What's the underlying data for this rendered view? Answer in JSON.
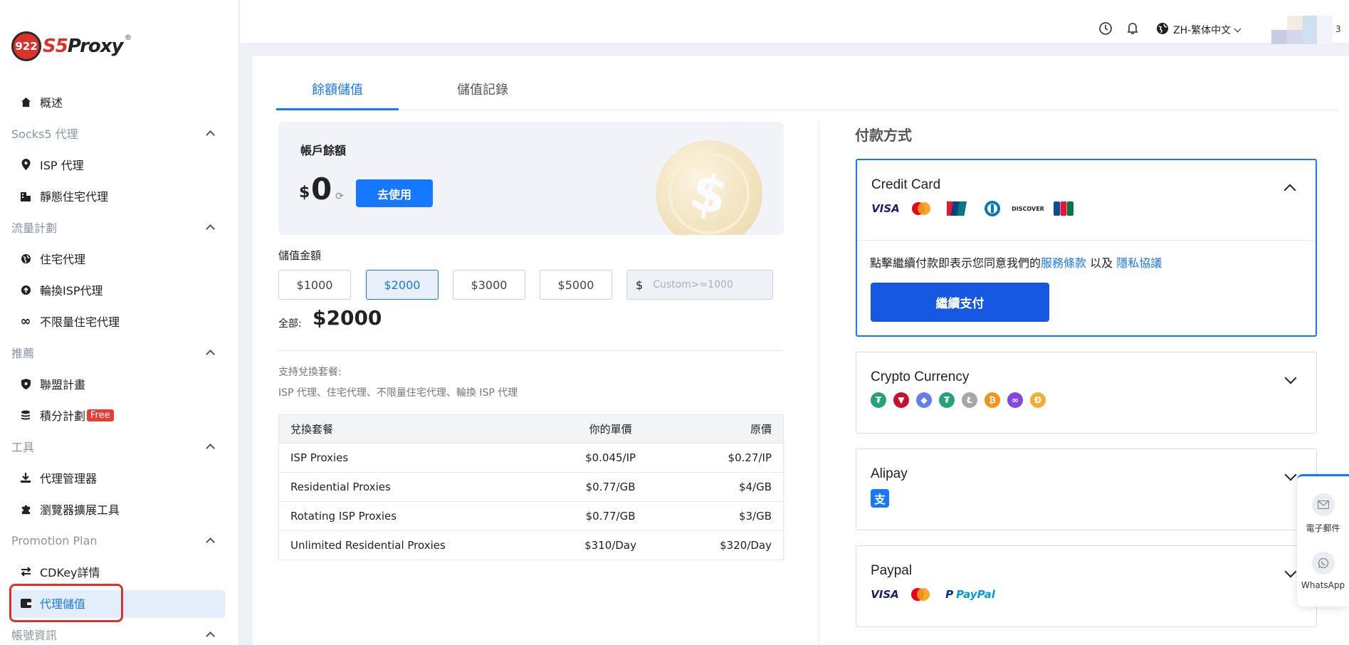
{
  "brand": {
    "logo_badge": "922",
    "logo_name_a": "S5",
    "logo_name_b": "Proxy",
    "registered": "®"
  },
  "sidebar": {
    "overview": "概述",
    "sections": [
      {
        "title": "Socks5 代理",
        "items": [
          "ISP 代理",
          "靜態住宅代理"
        ]
      },
      {
        "title": "流量計劃",
        "items": [
          "住宅代理",
          "輪換ISP代理",
          "不限量住宅代理"
        ]
      },
      {
        "title": "推薦",
        "items": [
          "聯盟計畫",
          "積分計劃"
        ]
      },
      {
        "title": "工具",
        "items": [
          "代理管理器",
          "瀏覽器擴展工具"
        ]
      },
      {
        "title": "Promotion Plan",
        "items": [
          "CDKey詳情",
          "代理儲值"
        ]
      },
      {
        "title": "帳號資訊",
        "items": []
      }
    ],
    "free_badge": "Free",
    "active_item": "代理儲值"
  },
  "topbar": {
    "language": "ZH-繁体中文",
    "avatar_suffix": "3"
  },
  "tabs": [
    "餘額儲值",
    "儲值記錄"
  ],
  "balance": {
    "title": "帳戶餘額",
    "currency": "$",
    "amount": "0",
    "use_button": "去使用"
  },
  "recharge": {
    "label": "儲值金額",
    "options": [
      "$1000",
      "$2000",
      "$3000",
      "$5000"
    ],
    "selected": "$2000",
    "custom_currency": "$",
    "custom_placeholder": "Custom>=1000",
    "total_label": "全部:",
    "total_value": "$2000"
  },
  "support": {
    "title": "支持兌換套餐:",
    "list": "ISP 代理、住宅代理、不限量住宅代理、輪換 ISP 代理"
  },
  "pricing": {
    "headers": [
      "兌換套餐",
      "你的單價",
      "原價"
    ],
    "rows": [
      [
        "ISP Proxies",
        "$0.045/IP",
        "$0.27/IP"
      ],
      [
        "Residential Proxies",
        "$0.77/GB",
        "$4/GB"
      ],
      [
        "Rotating ISP Proxies",
        "$0.77/GB",
        "$3/GB"
      ],
      [
        "Unlimited Residential Proxies",
        "$310/Day",
        "$320/Day"
      ]
    ]
  },
  "payment": {
    "title": "付款方式",
    "methods": [
      "Credit Card",
      "Crypto Currency",
      "Alipay",
      "Paypal"
    ],
    "card_logos": [
      "VISA",
      "Mastercard",
      "UnionPay",
      "Diners",
      "DISCOVER",
      "JCB"
    ],
    "crypto_icons": [
      "tether-icon",
      "tron-icon",
      "ethereum-icon",
      "usdt-icon",
      "litecoin-icon",
      "bitcoin-icon",
      "polygon-icon",
      "dai-icon"
    ],
    "terms_prefix": "點擊繼續付款即表示您同意我們的",
    "terms_link": "服務條款",
    "terms_and": "以及",
    "privacy_link": "隱私協議",
    "continue_button": "繼續支付",
    "paypal_logos": [
      "VISA",
      "Mastercard",
      "PayPal"
    ]
  },
  "contact": {
    "email": "電子郵件",
    "whatsapp": "WhatsApp"
  },
  "colors": {
    "primary": "#1677ff",
    "continue": "#1758e3",
    "highlight": "#d9332b",
    "active_bg": "#e4eefb"
  }
}
